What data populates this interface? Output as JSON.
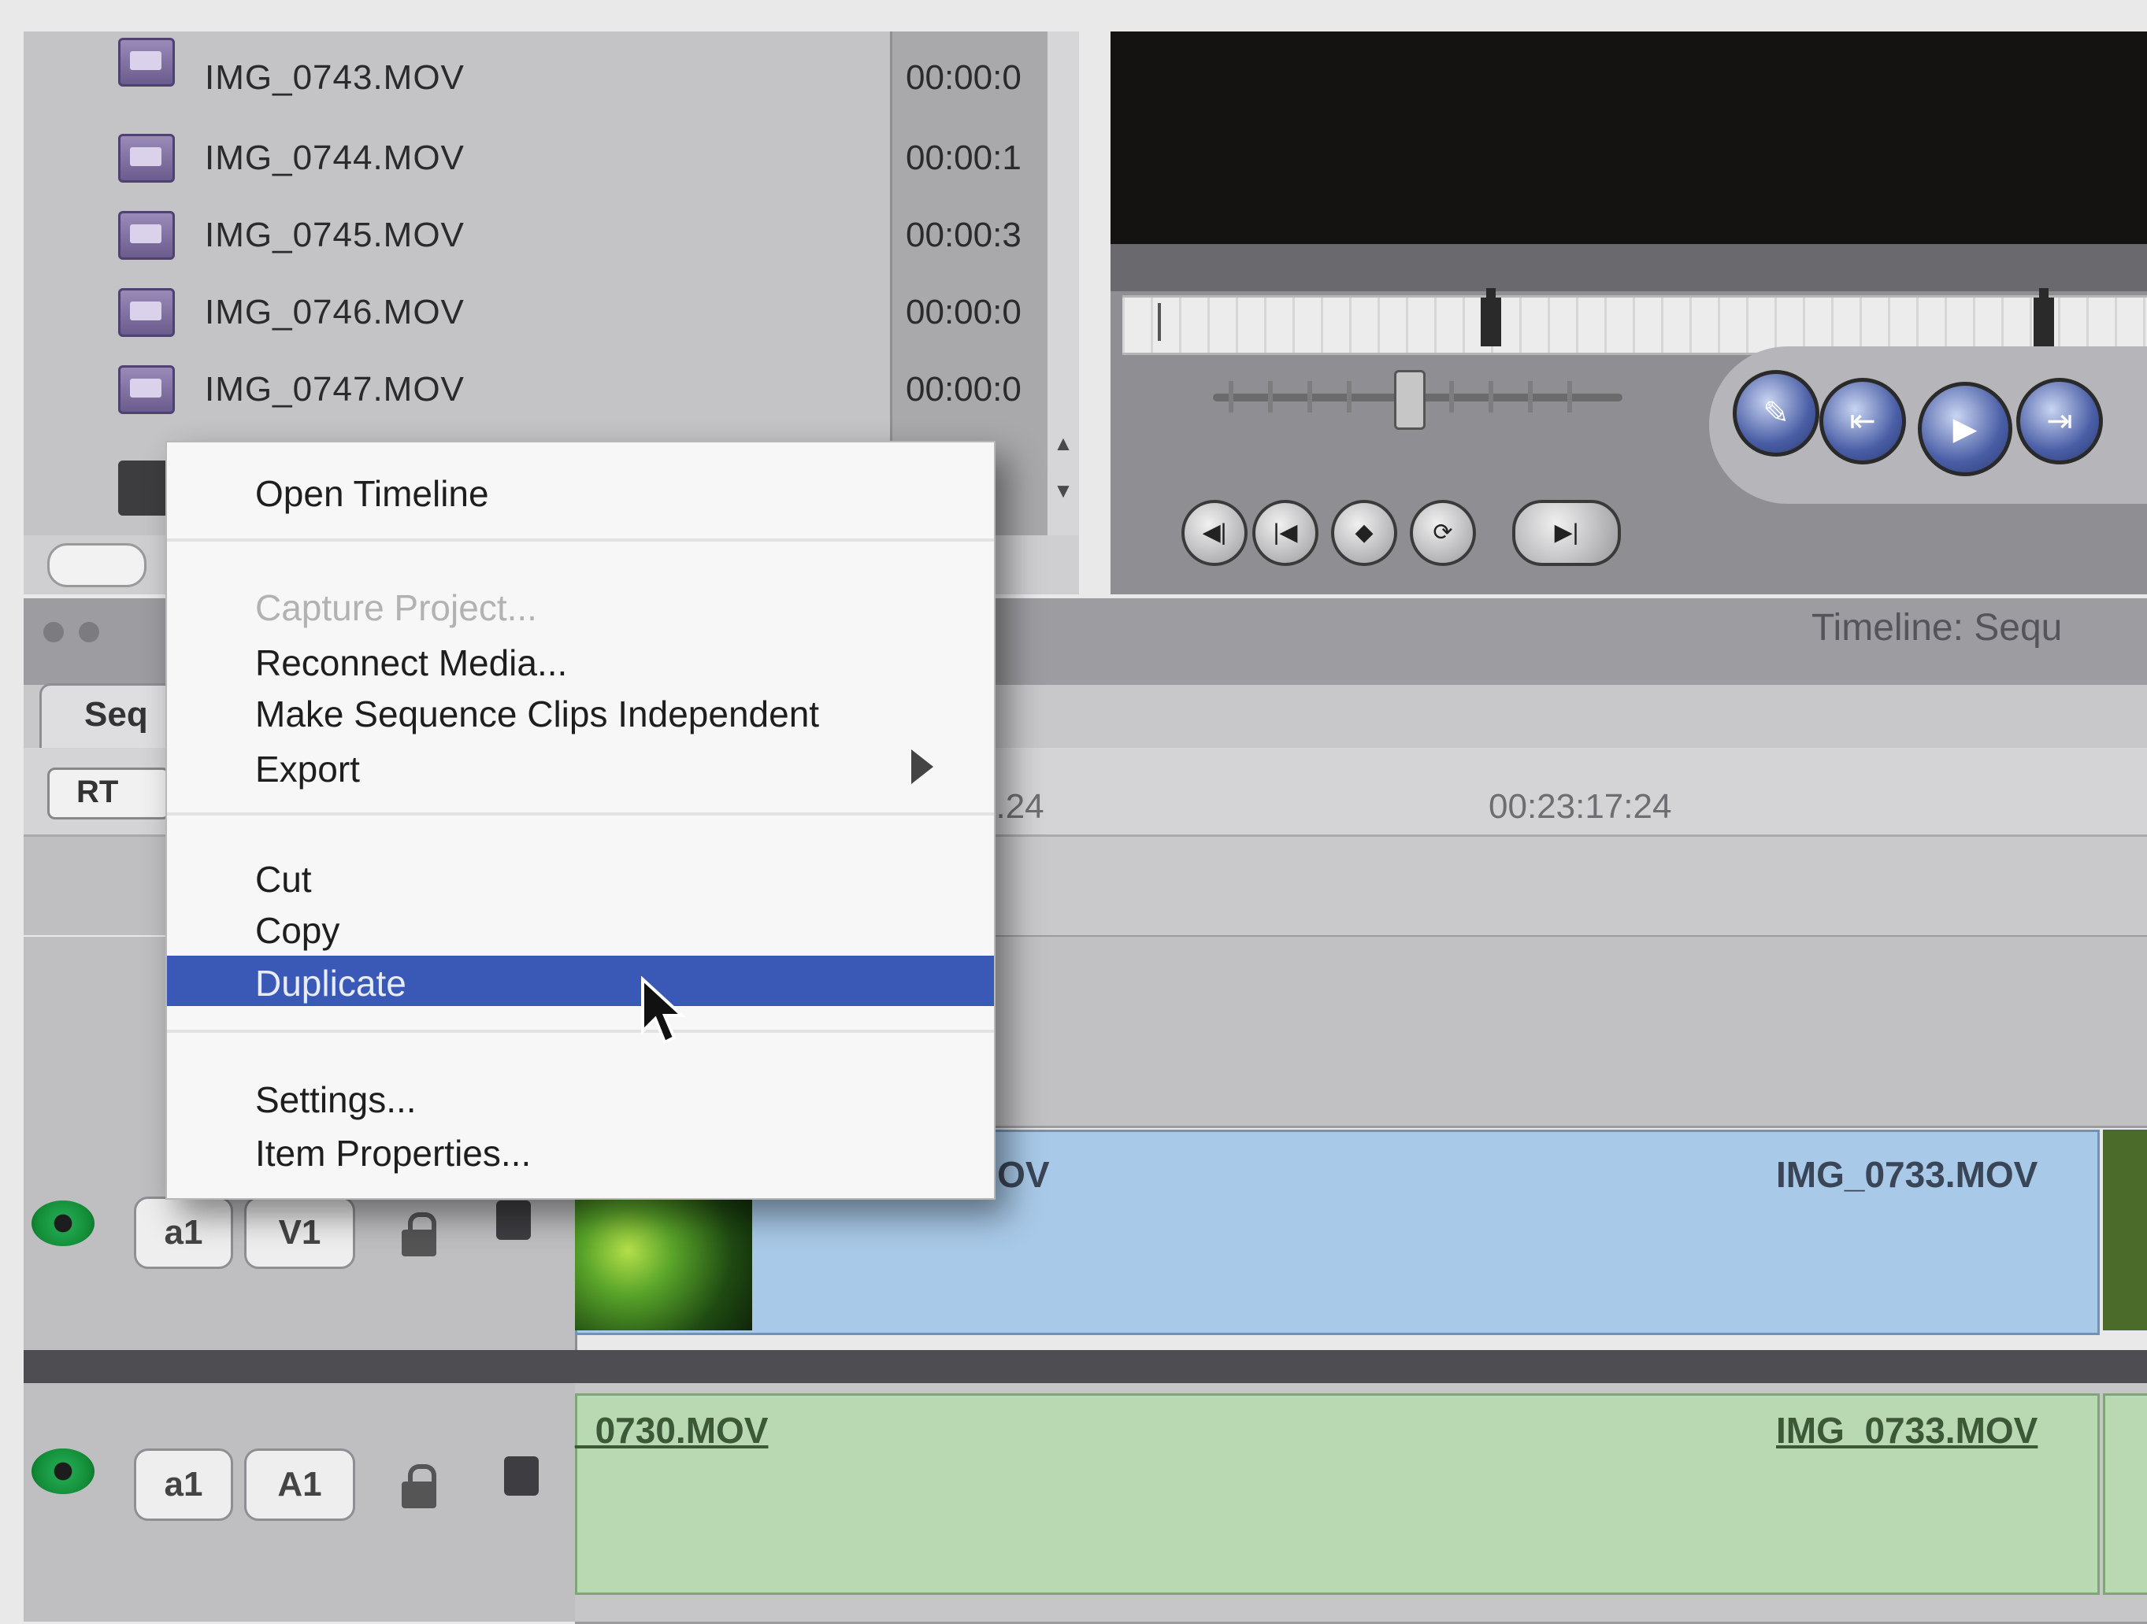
{
  "browser": {
    "clips": [
      {
        "name": "IMG_0743.MOV",
        "duration": "00:00:0"
      },
      {
        "name": "IMG_0744.MOV",
        "duration": "00:00:1"
      },
      {
        "name": "IMG_0745.MOV",
        "duration": "00:00:3"
      },
      {
        "name": "IMG_0746.MOV",
        "duration": "00:00:0"
      },
      {
        "name": "IMG_0747.MOV",
        "duration": "00:00:0"
      }
    ]
  },
  "viewer": {
    "edit_buttons": [
      "◀|",
      "|◀",
      "◆",
      "⟳",
      "▶|"
    ],
    "transport_buttons": [
      "✎",
      "⇤",
      "▶",
      "⇥"
    ]
  },
  "timeline": {
    "title": "Timeline: Sequ",
    "sequence_tab": "Seq",
    "timecode_field": "RT",
    "ruler_timecodes": [
      "3.24",
      "00:23:17:24"
    ],
    "tracks": {
      "v1": {
        "src": "a1",
        "dest": "V1",
        "clip_left": ".MOV",
        "clip_right": "IMG_0733.MOV"
      },
      "a1": {
        "src": "a1",
        "dest": "A1",
        "clip_left": "_0730.MOV",
        "clip_right": "IMG_0733.MOV"
      }
    }
  },
  "context_menu": {
    "items": [
      {
        "label": "Open Timeline",
        "state": "normal"
      },
      {
        "label": "Capture Project...",
        "state": "disabled"
      },
      {
        "label": "Reconnect Media...",
        "state": "normal"
      },
      {
        "label": "Make Sequence Clips Independent",
        "state": "normal"
      },
      {
        "label": "Export",
        "state": "normal",
        "submenu": true
      },
      {
        "label": "Cut",
        "state": "normal"
      },
      {
        "label": "Copy",
        "state": "normal"
      },
      {
        "label": "Duplicate",
        "state": "highlighted"
      },
      {
        "label": "Settings...",
        "state": "normal"
      },
      {
        "label": "Item Properties...",
        "state": "normal"
      }
    ]
  },
  "colors": {
    "menu_highlight": "#3a59b6",
    "video_clip": "#a8c9e8",
    "audio_clip": "#b8d9b2",
    "track_visibility": "#20a44d"
  }
}
